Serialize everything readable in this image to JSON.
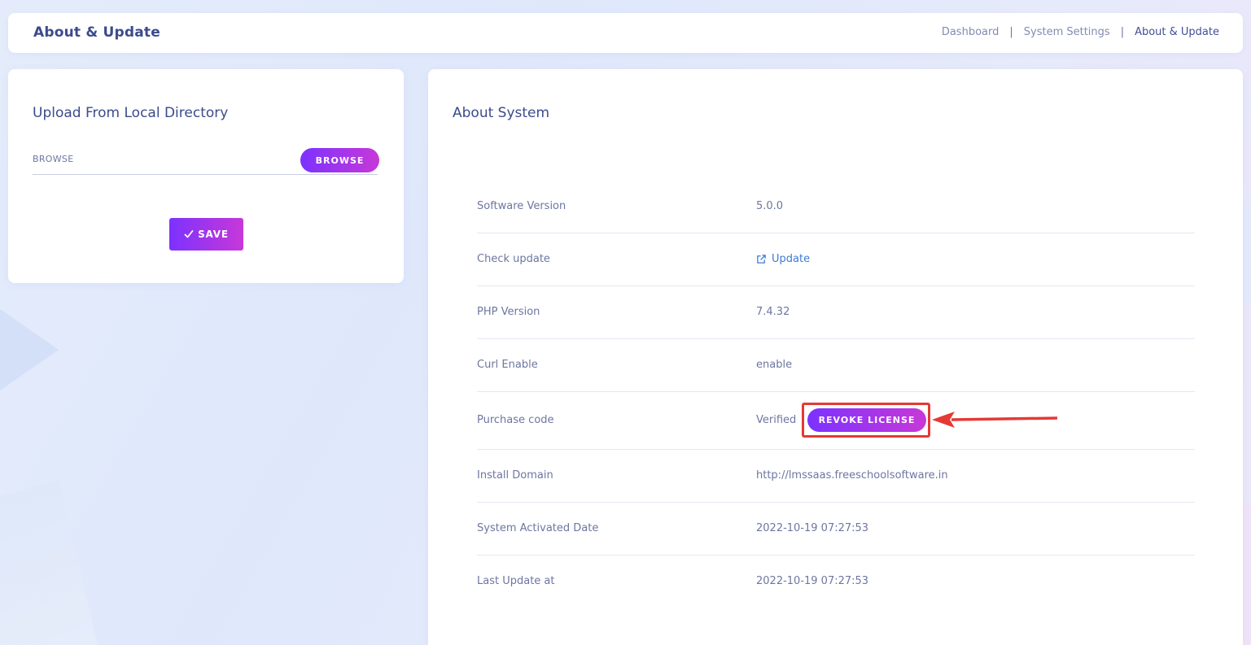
{
  "header": {
    "title": "About & Update",
    "breadcrumb": [
      "Dashboard",
      "System Settings",
      "About & Update"
    ],
    "separator": "|"
  },
  "upload": {
    "title": "Upload From Local Directory",
    "browse_label": "BROWSE",
    "browse_button": "BROWSE",
    "save_button": "SAVE"
  },
  "about": {
    "title": "About System",
    "rows": [
      {
        "label": "Software Version",
        "value": "5.0.0"
      },
      {
        "label": "Check update",
        "value": "Update"
      },
      {
        "label": "PHP Version",
        "value": "7.4.32"
      },
      {
        "label": "Curl Enable",
        "value": "enable"
      },
      {
        "label": "Purchase code",
        "value": "Verified"
      },
      {
        "label": "Install Domain",
        "value": "http://lmssaas.freeschoolsoftware.in"
      },
      {
        "label": "System Activated Date",
        "value": "2022-10-19 07:27:53"
      },
      {
        "label": "Last Update at",
        "value": "2022-10-19 07:27:53"
      }
    ],
    "revoke_button": "REVOKE LICENSE"
  },
  "colors": {
    "accent_gradient_start": "#7c32ff",
    "accent_gradient_end": "#c738d8",
    "highlight_box": "#e53935",
    "link": "#3c7bd4",
    "title": "#3b4b8c"
  },
  "icons": {
    "update_link": "external-link-icon",
    "save_button": "checkmark-icon",
    "annotation": "red-arrow-icon"
  }
}
